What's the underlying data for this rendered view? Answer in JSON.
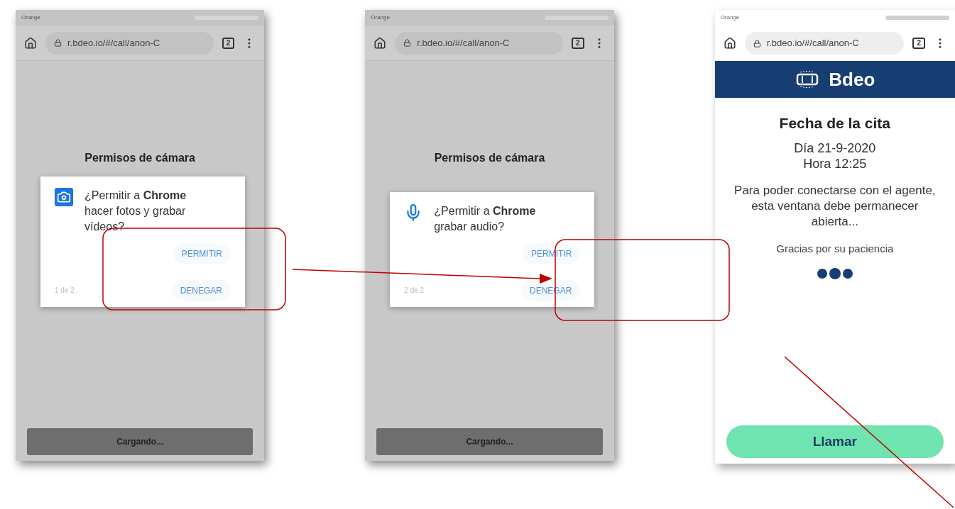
{
  "phones": [
    {
      "kind": "permission",
      "carrier": "Orange",
      "url": "r.bdeo.io/#/call/anon-C",
      "tab_count": "2",
      "page_title": "Permisos de cámara",
      "dialog": {
        "kind": "camera",
        "message": "¿Permitir a **Chrome** hacer fotos y grabar vídeos?",
        "buttons": [
          "PERMITIR",
          "DENEGAR"
        ],
        "counter": "1 de 2"
      },
      "footer_button": "Cargando..."
    },
    {
      "kind": "permission",
      "carrier": "Orange",
      "url": "r.bdeo.io/#/call/anon-C",
      "tab_count": "2",
      "page_title": "Permisos de cámara",
      "dialog": {
        "kind": "microphone",
        "message": "¿Permitir a **Chrome** grabar audio?",
        "buttons": [
          "PERMITIR",
          "DENEGAR"
        ],
        "counter": "2 de 2"
      },
      "footer_button": "Cargando..."
    },
    {
      "kind": "appointment",
      "carrier": "Orange",
      "url": "r.bdeo.io/#/call/anon-C",
      "tab_count": "2",
      "brand": "Bdeo",
      "title": "Fecha de la cita",
      "date": "Día 21-9-2020",
      "time": "Hora 12:25",
      "message": "Para poder conectarse con el agente, esta ventana debe permanecer abierta...",
      "thanks": "Gracias por su paciencia",
      "call_button": "Llamar"
    }
  ]
}
